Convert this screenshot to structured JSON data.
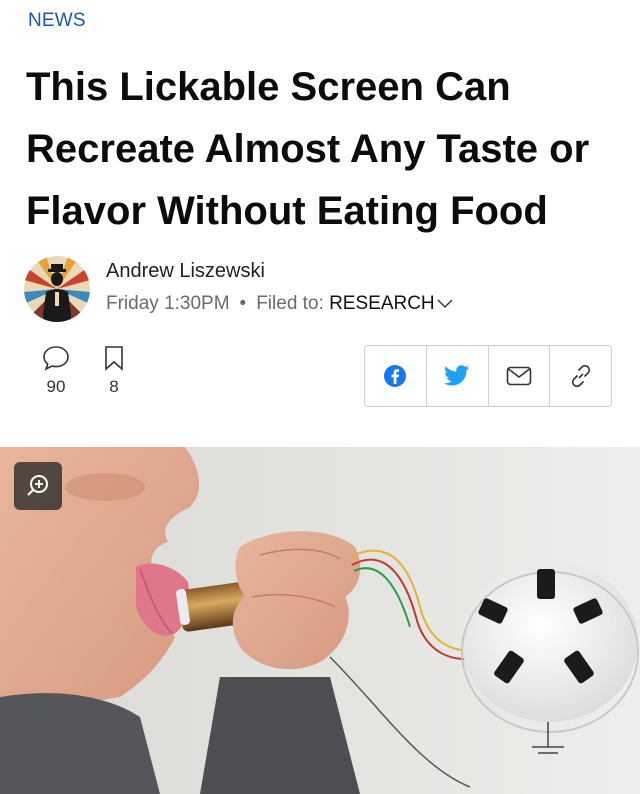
{
  "article": {
    "section": "NEWS",
    "title": "This Lickable Screen Can Recreate Almost Any Taste or Flavor Without Eating Food"
  },
  "author": {
    "name": "Andrew Liszewski",
    "date": "Friday 1:30PM",
    "separator": "•",
    "filed_label": "Filed to:",
    "filed_value": "RESEARCH"
  },
  "stats": {
    "comments": "90",
    "bookmarks": "8"
  },
  "share": {
    "buttons": [
      "facebook-icon",
      "twitter-icon",
      "email-icon",
      "link-icon"
    ]
  },
  "colors": {
    "section": "#1a56b7",
    "facebook": "#1877f2",
    "twitter": "#1da1f2"
  }
}
